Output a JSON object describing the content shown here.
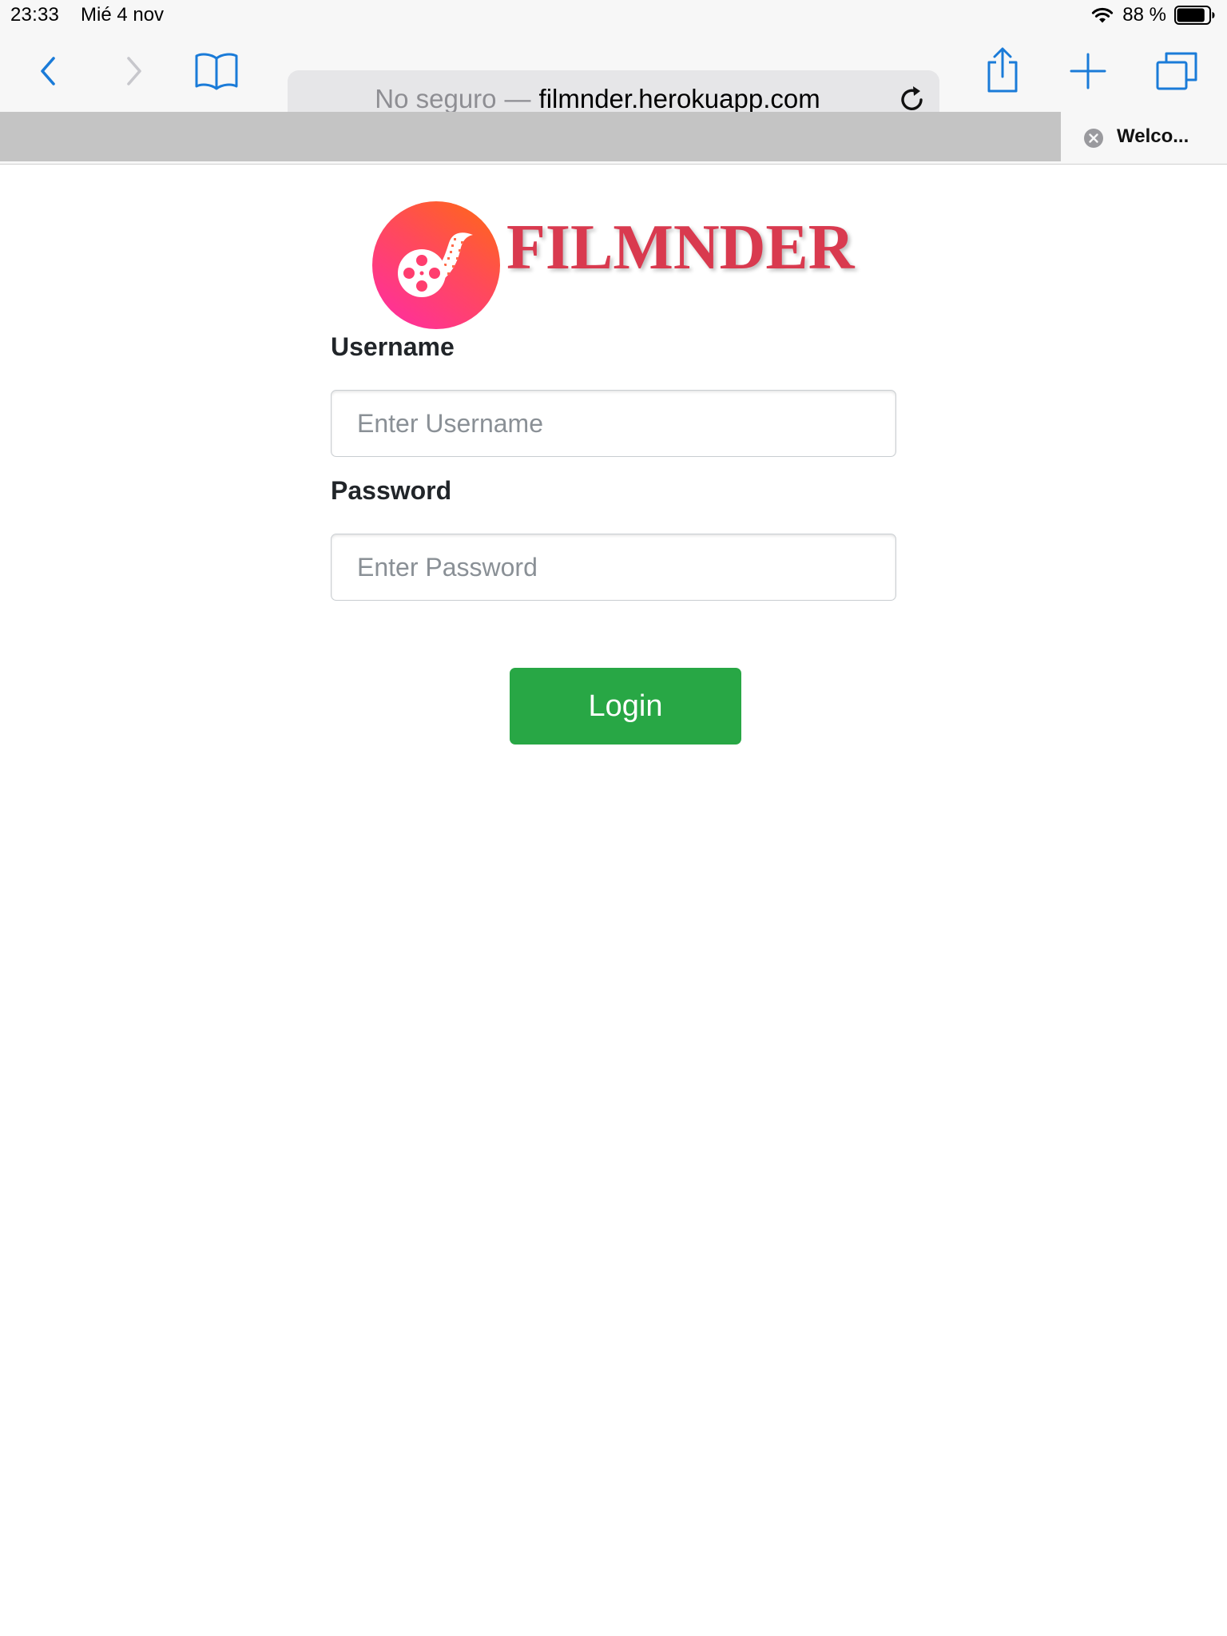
{
  "status_bar": {
    "time": "23:33",
    "date": "Mié 4 nov",
    "battery_percent": "88 %",
    "battery_level": 0.88
  },
  "toolbar": {
    "address": {
      "security_label": "No seguro",
      "separator": "—",
      "domain": "filmnder.herokuapp.com"
    },
    "icons": {
      "back": "chevron-left-icon",
      "forward": "chevron-right-icon",
      "bookmarks": "book-icon",
      "reload": "reload-icon",
      "share": "share-icon",
      "new_tab": "plus-icon",
      "tabs": "tabs-icon"
    },
    "accent_color": "#1a7bd8"
  },
  "tabs": {
    "active_title": "Welco..."
  },
  "page": {
    "brand_name": "FILMNDER",
    "brand_color": "#d93a4f",
    "form": {
      "username_label": "Username",
      "username_placeholder": "Enter Username",
      "password_label": "Password",
      "password_placeholder": "Enter Password",
      "login_label": "Login",
      "login_color": "#28a745"
    }
  }
}
